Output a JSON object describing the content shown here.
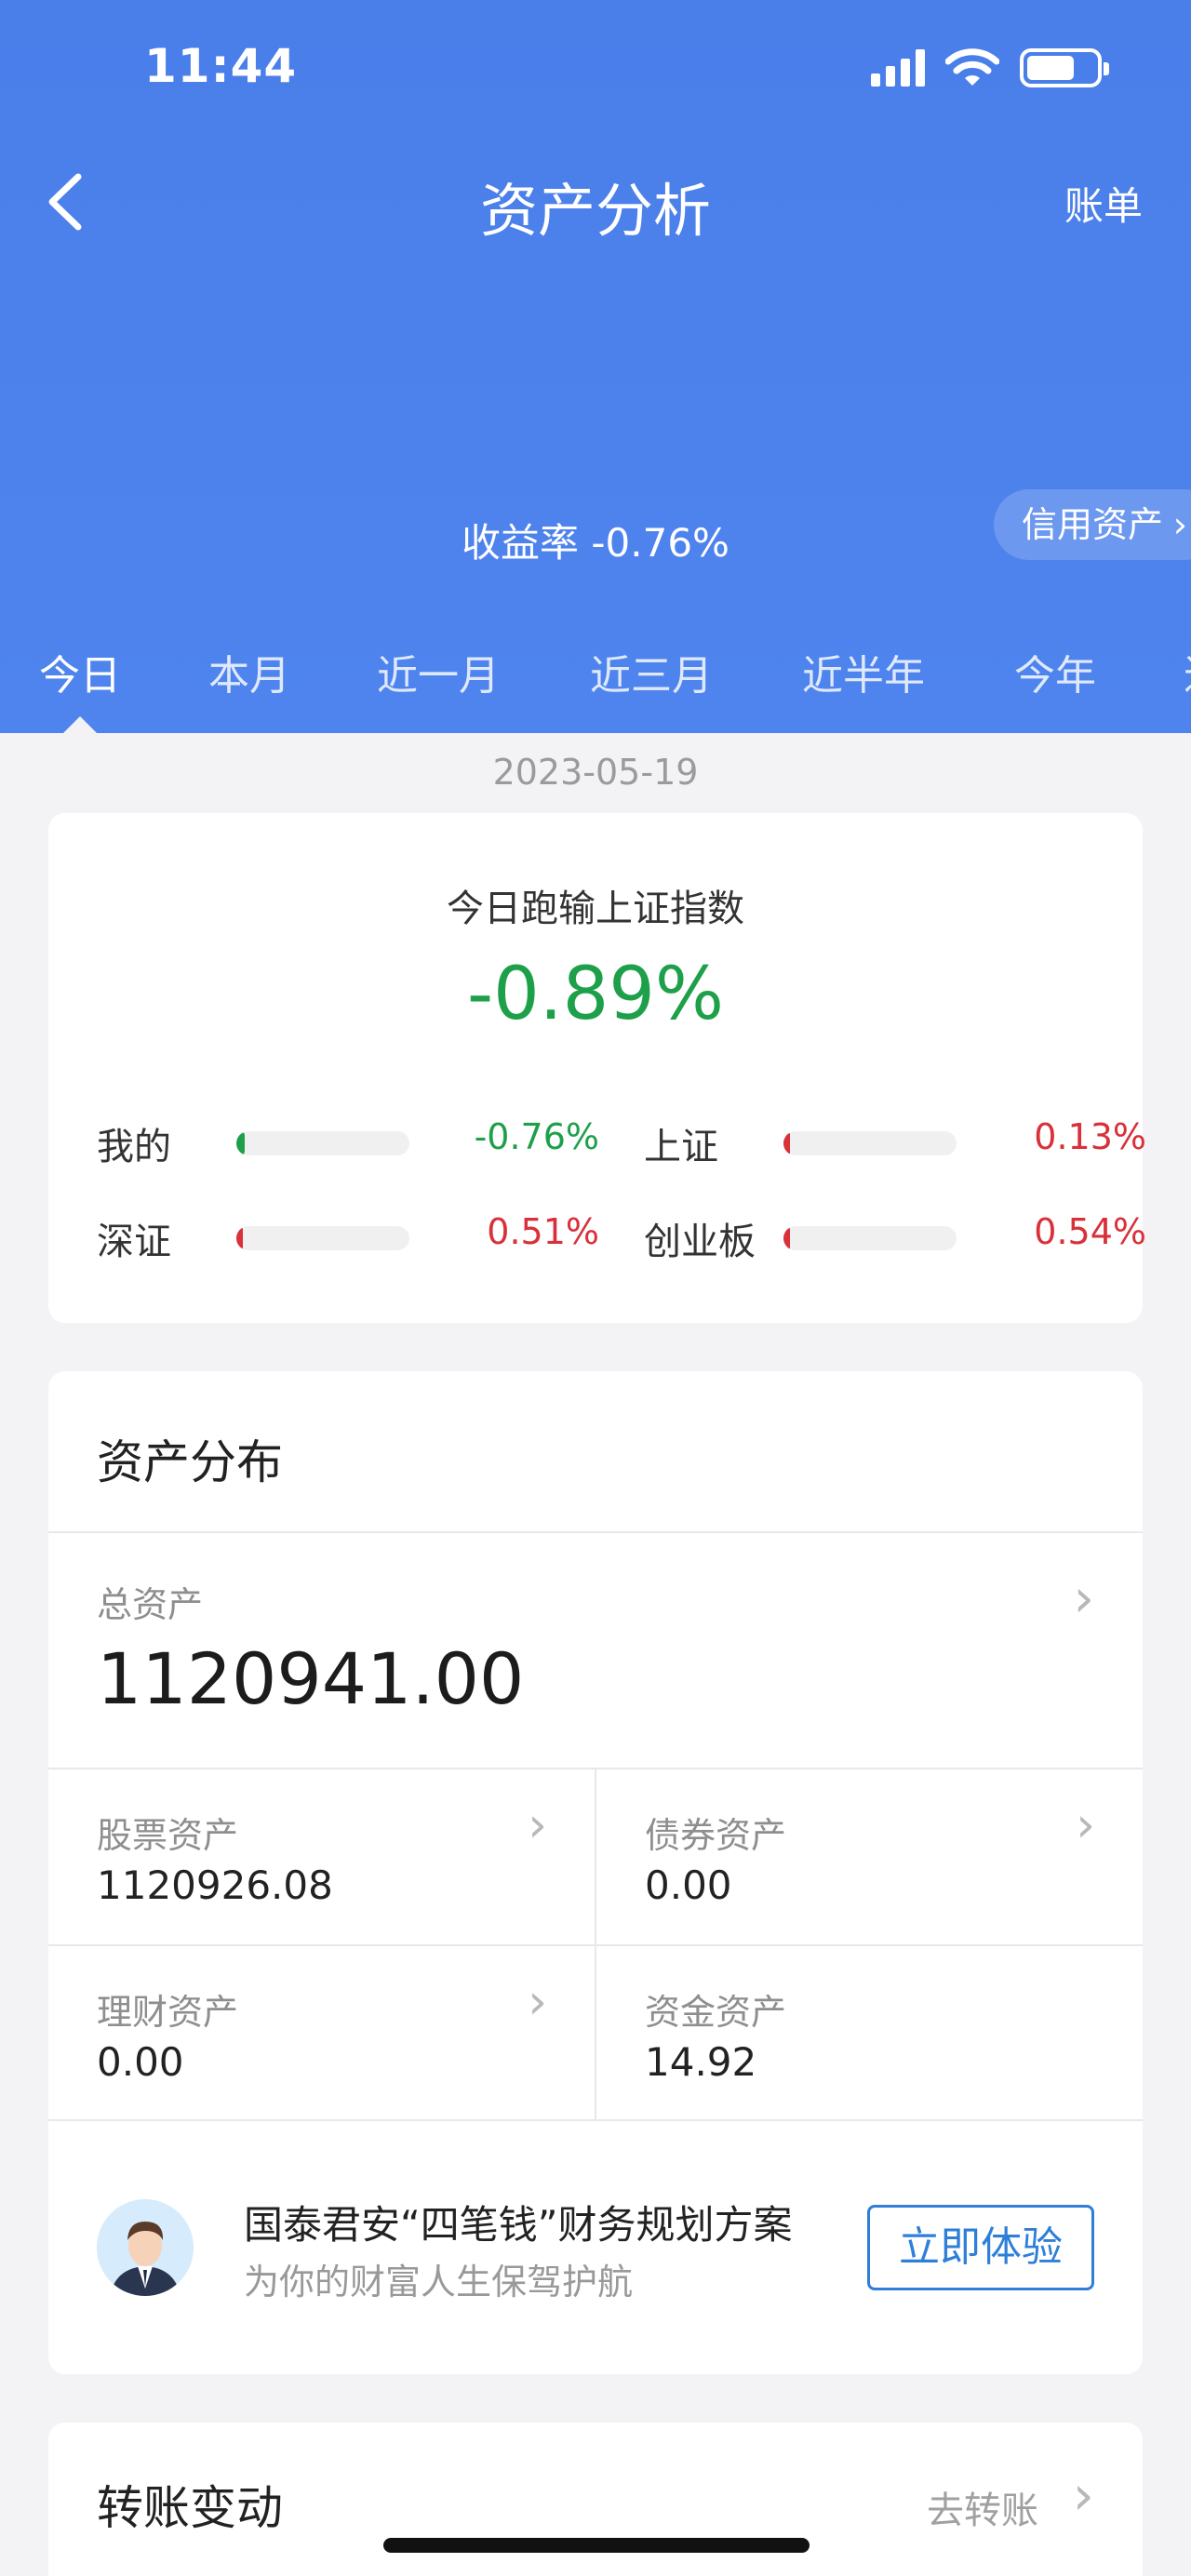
{
  "status_bar": {
    "time": "11:44"
  },
  "nav": {
    "title": "资产分析",
    "right_label": "账单"
  },
  "summary": {
    "return_rate": "收益率 -0.76%",
    "credit_label": "信用资产"
  },
  "tabs": [
    "今日",
    "本月",
    "近一月",
    "近三月",
    "近半年",
    "今年",
    "近"
  ],
  "date": "2023-05-19",
  "compare": {
    "title": "今日跑输上证指数",
    "value": "-0.89%",
    "indices": [
      {
        "label": "我的",
        "value": "-0.76%",
        "level": 0.76,
        "color": "#1ea04b"
      },
      {
        "label": "上证",
        "value": "0.13%",
        "level": 0.13,
        "color": "#d9303a"
      },
      {
        "label": "深证",
        "value": "0.51%",
        "level": 0.51,
        "color": "#d9303a"
      },
      {
        "label": "创业板",
        "value": "0.54%",
        "level": 0.54,
        "color": "#d9303a"
      }
    ]
  },
  "assets": {
    "title": "资产分布",
    "total_label": "总资产",
    "total_value": "1120941.00",
    "items": [
      {
        "label": "股票资产",
        "value": "1120926.08",
        "has_link": true
      },
      {
        "label": "债券资产",
        "value": "0.00",
        "has_link": true
      },
      {
        "label": "理财资产",
        "value": "0.00",
        "has_link": true
      },
      {
        "label": "资金资产",
        "value": "14.92",
        "has_link": false
      }
    ]
  },
  "promo": {
    "title": "国泰君安“四笔钱”财务规划方案",
    "subtitle": "为你的财富人生保驾护航",
    "button": "立即体验"
  },
  "transfer": {
    "title": "转账变动",
    "link": "去转账"
  },
  "colors": {
    "header_blue": "#4a7ee9",
    "gain_red": "#d9303a",
    "loss_green": "#1ea04b",
    "accent_blue": "#2f7fd8"
  }
}
